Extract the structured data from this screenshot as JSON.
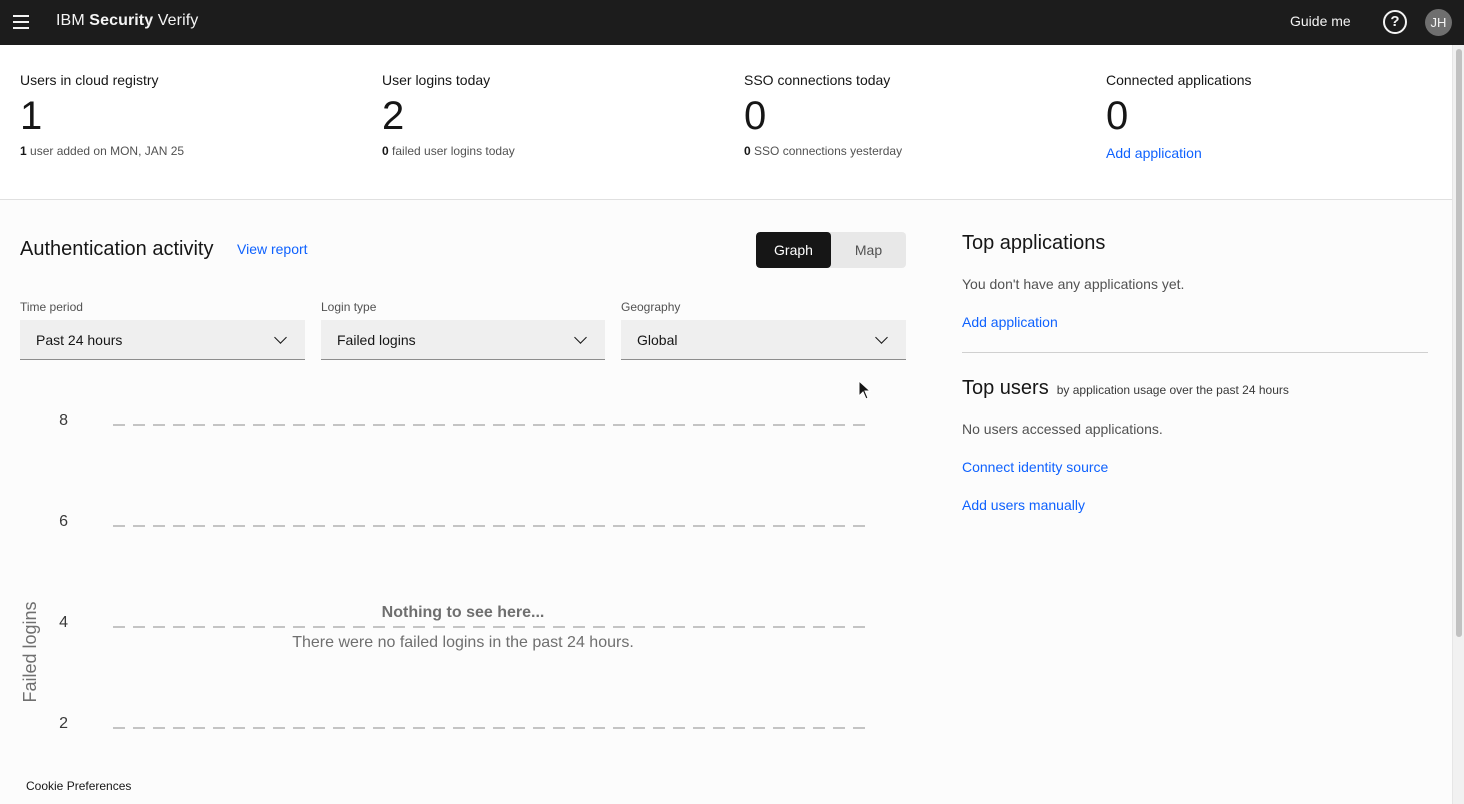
{
  "header": {
    "brand_prefix": "IBM",
    "brand_bold": "Security",
    "brand_suffix": "Verify",
    "guide_label": "Guide me",
    "help_icon_glyph": "?",
    "avatar_initials": "JH",
    "menu_icon": "hamburger-icon"
  },
  "stats": [
    {
      "label": "Users in cloud registry",
      "value": "1",
      "sub_bold": "1",
      "sub_text": "user added on MON, JAN 25"
    },
    {
      "label": "User logins today",
      "value": "2",
      "sub_bold": "0",
      "sub_text": "failed user logins today"
    },
    {
      "label": "SSO connections today",
      "value": "0",
      "sub_bold": "0",
      "sub_text": "SSO connections yesterday"
    },
    {
      "label": "Connected applications",
      "value": "0",
      "link": "Add application"
    }
  ],
  "auth": {
    "title": "Authentication activity",
    "view_report": "View report",
    "toggle_graph": "Graph",
    "toggle_map": "Map",
    "time_period_label": "Time period",
    "time_period_value": "Past 24 hours",
    "login_type_label": "Login type",
    "login_type_value": "Failed logins",
    "geography_label": "Geography",
    "geography_value": "Global"
  },
  "chart_data": {
    "type": "line",
    "ylabel": "Failed logins",
    "yticks": [
      8,
      6,
      4,
      2
    ],
    "empty_title": "Nothing to see here...",
    "empty_message": "There were no failed logins in the past 24 hours.",
    "series": []
  },
  "right": {
    "top_apps_title": "Top applications",
    "top_apps_empty": "You don't have any applications yet.",
    "top_apps_link": "Add application",
    "top_users_title": "Top users",
    "top_users_sub": "by application usage over the past 24 hours",
    "top_users_empty": "No users accessed applications.",
    "connect_identity": "Connect identity source",
    "add_users": "Add users manually"
  },
  "footer": {
    "cookie": "Cookie Preferences"
  },
  "colors": {
    "topbar": "#1c1c1c",
    "link": "#0f62fe",
    "toggle_active": "#161616"
  }
}
